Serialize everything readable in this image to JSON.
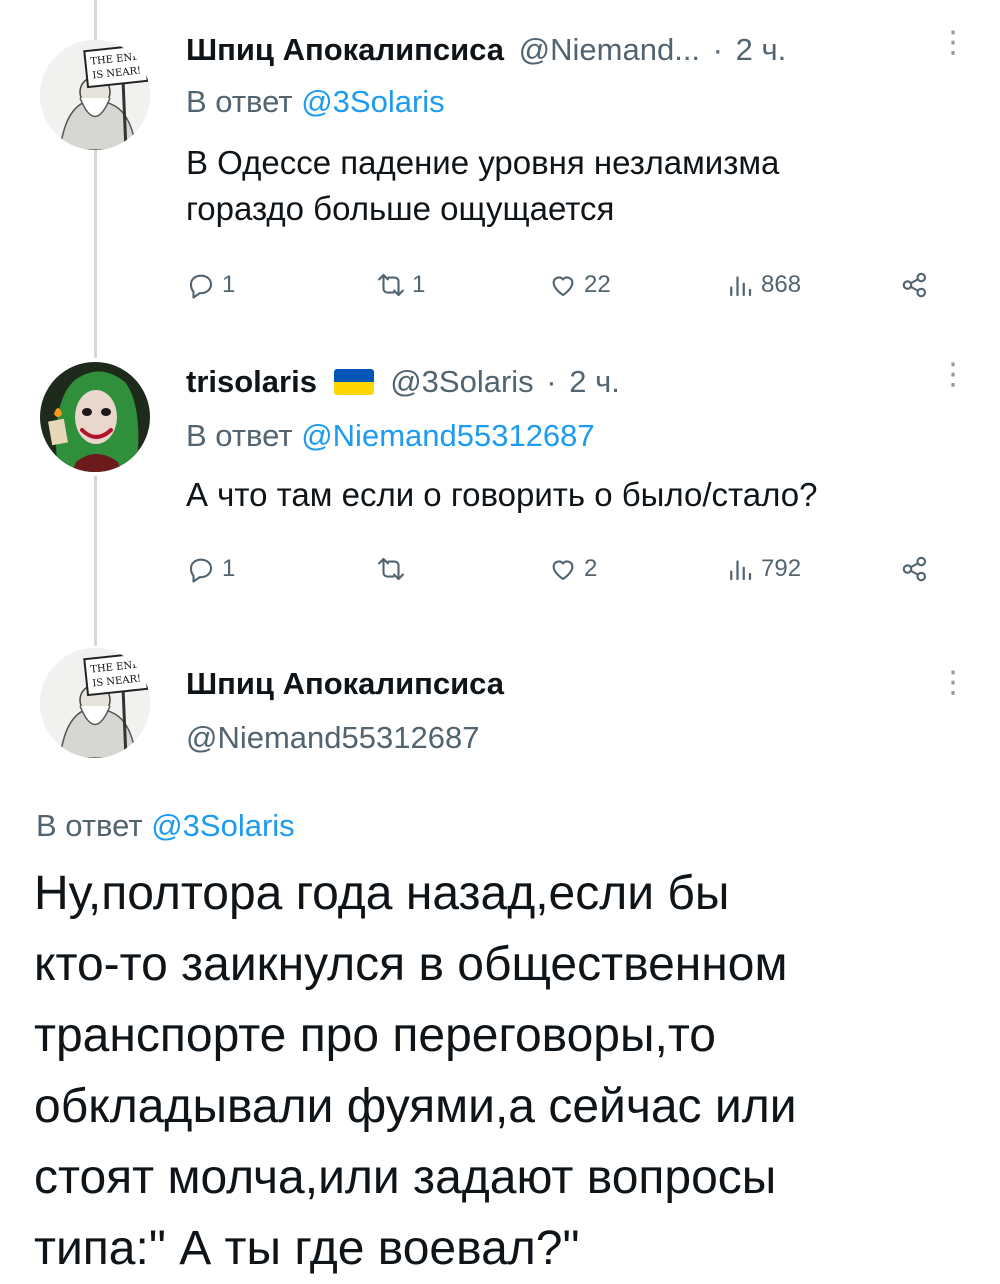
{
  "tweets": [
    {
      "name": "Шпиц Апокалипсиса",
      "handle": "@Niemand...",
      "separator": "·",
      "time": "2 ч.",
      "reply_prefix": "В ответ",
      "reply_to": "@3Solaris",
      "text_lines": [
        "В Одессе падение уровня незламизма",
        "гораздо больше ощущается"
      ],
      "replies": "1",
      "retweets": "1",
      "likes": "22",
      "views": "868",
      "avatar_sign": [
        "THE END",
        "IS NEAR!"
      ]
    },
    {
      "name": "trisolaris",
      "handle": "@3Solaris",
      "separator": "·",
      "time": "2 ч.",
      "reply_prefix": "В ответ",
      "reply_to": "@Niemand55312687",
      "text_lines": [
        "А что там если о говорить о было/стало?"
      ],
      "replies": "1",
      "retweets": "",
      "likes": "2",
      "views": "792",
      "flag_colors": [
        "#0057b7",
        "#ffd700"
      ]
    }
  ],
  "main_tweet": {
    "name": "Шпиц Апокалипсиса",
    "handle": "@Niemand55312687",
    "reply_prefix": "В ответ",
    "reply_to": "@3Solaris",
    "text_lines": [
      "Ну,полтора года назад,если бы",
      "кто-то заикнулся в общественном",
      "транспорте про переговоры,то",
      "обкладывали фуями,а сейчас или",
      "стоят молча,или задают вопросы",
      "типа:\" А ты где воевал?\""
    ],
    "avatar_sign": [
      "THE END",
      "IS NEAR!"
    ]
  },
  "icons": {
    "reply": "reply-icon",
    "retweet": "retweet-icon",
    "like": "heart-icon",
    "views": "views-icon",
    "share": "share-icon",
    "more": "more-icon"
  },
  "colors": {
    "link": "#1d9bf0",
    "muted": "#536471",
    "text": "#0f1419",
    "thread_line": "#cfd9de"
  }
}
